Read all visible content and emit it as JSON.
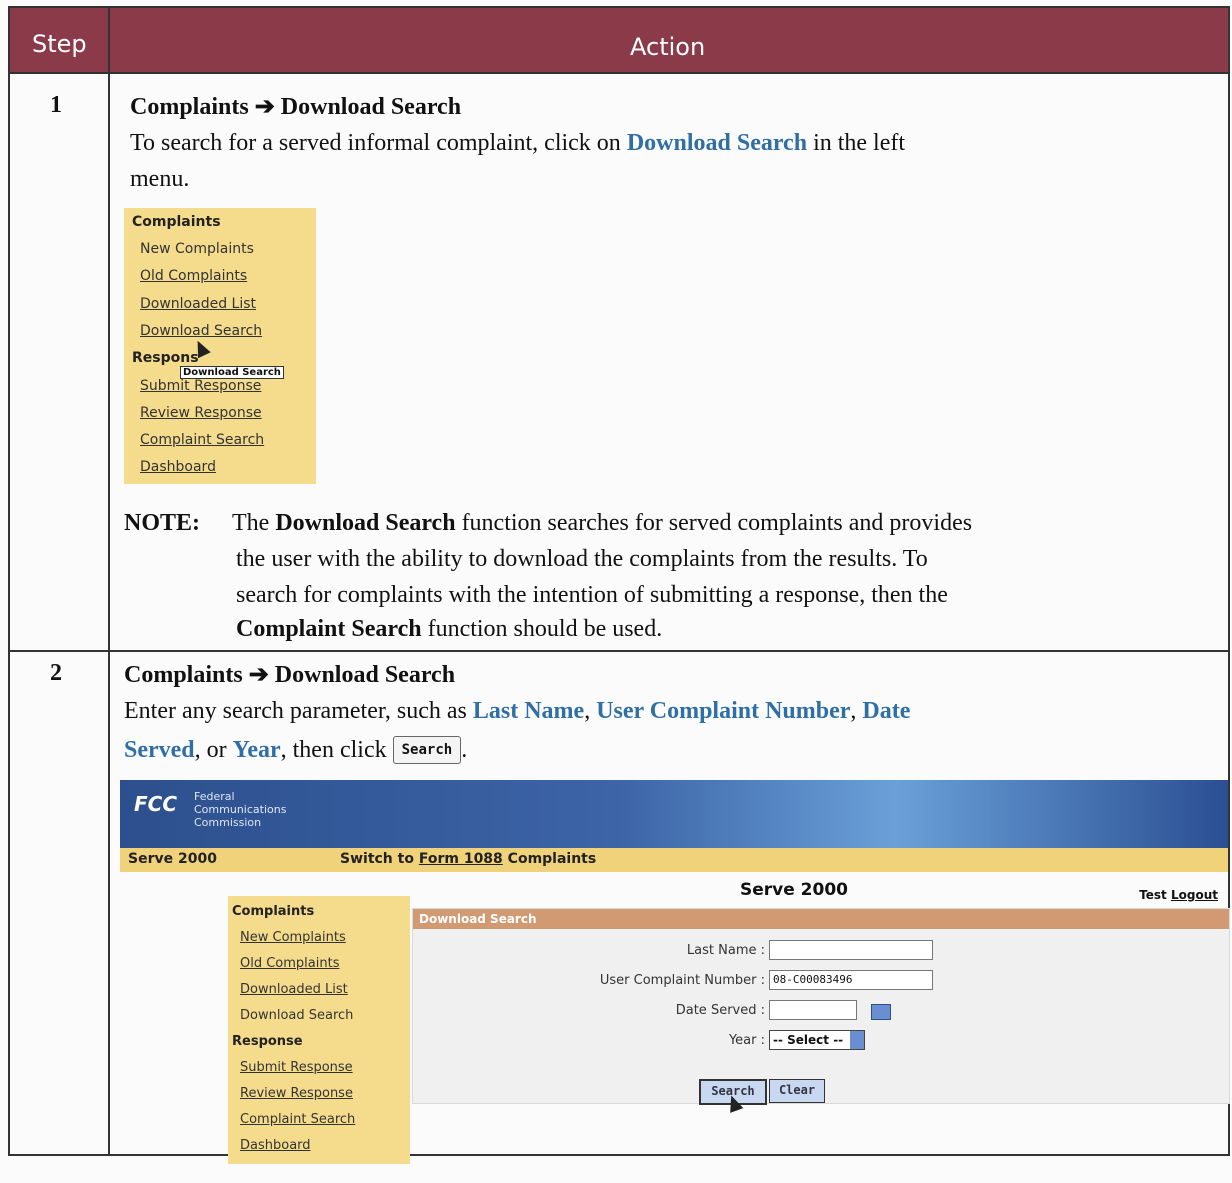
{
  "header": {
    "step": "Step",
    "action": "Action"
  },
  "step1": {
    "num": "1",
    "path_start": "Complaints",
    "arrow": "➔",
    "path_end": "Download Search",
    "line1_a": "To search for a served informal complaint, click on ",
    "line1_link": "Download Search",
    "line1_b": " in the left",
    "line2": "menu.",
    "menu": {
      "complaints": "Complaints",
      "new": "New Complaints",
      "old": "Old Complaints",
      "downloaded": "Downloaded List",
      "download_search": "Download Search",
      "response_partial": "Respons",
      "submit": "Submit Response",
      "review": "Review Response",
      "complaint_search": "Complaint Search",
      "dashboard": "Dashboard",
      "tooltip": "Download Search"
    },
    "note_label": "NOTE:",
    "note_l1_a": "The ",
    "note_l1_b": "Download Search",
    "note_l1_c": " function searches for served complaints and provides",
    "note_l2": "the user with the ability to download the complaints from the results. To",
    "note_l3": "search for complaints with the intention of submitting a response, then the",
    "note_l4_a": "Complaint Search",
    "note_l4_b": " function should be used."
  },
  "step2": {
    "num": "2",
    "path_start": "Complaints",
    "arrow": "➔",
    "path_end": "Download Search",
    "l1_a": "Enter any search parameter, such as ",
    "l1_b": "Last Name",
    "l1_c": ", ",
    "l1_d": "User Complaint Number",
    "l1_e": ", ",
    "l1_f": "Date",
    "l2_a": "Served",
    "l2_b": ", or ",
    "l2_c": "Year",
    "l2_d": ", then click ",
    "l2_btn": "Search",
    "l2_e": "."
  },
  "fcc": {
    "logo": "FCC",
    "name1": "Federal",
    "name2": "Communications",
    "name3": "Commission",
    "bar_left": "Serve 2000",
    "bar_switch_a": "Switch to ",
    "bar_switch_link": "Form 1088",
    "bar_switch_b": " Complaints",
    "title": "Serve 2000",
    "user": "Test",
    "logout": "Logout",
    "menu": {
      "complaints": "Complaints",
      "new": "New Complaints",
      "old": "Old Complaints",
      "downloaded": "Downloaded List",
      "download_search": "Download Search",
      "response": "Response",
      "submit": "Submit Response",
      "review": "Review Response",
      "complaint_search": "Complaint Search",
      "dashboard": "Dashboard"
    },
    "panel_title": "Download Search",
    "last_name_label": "Last Name :",
    "ucn_label": "User Complaint Number :",
    "ucn_value": "08-C00083496",
    "date_label": "Date Served :",
    "year_label": "Year :",
    "year_value": "-- Select --",
    "search_btn": "Search",
    "clear_btn": "Clear"
  }
}
